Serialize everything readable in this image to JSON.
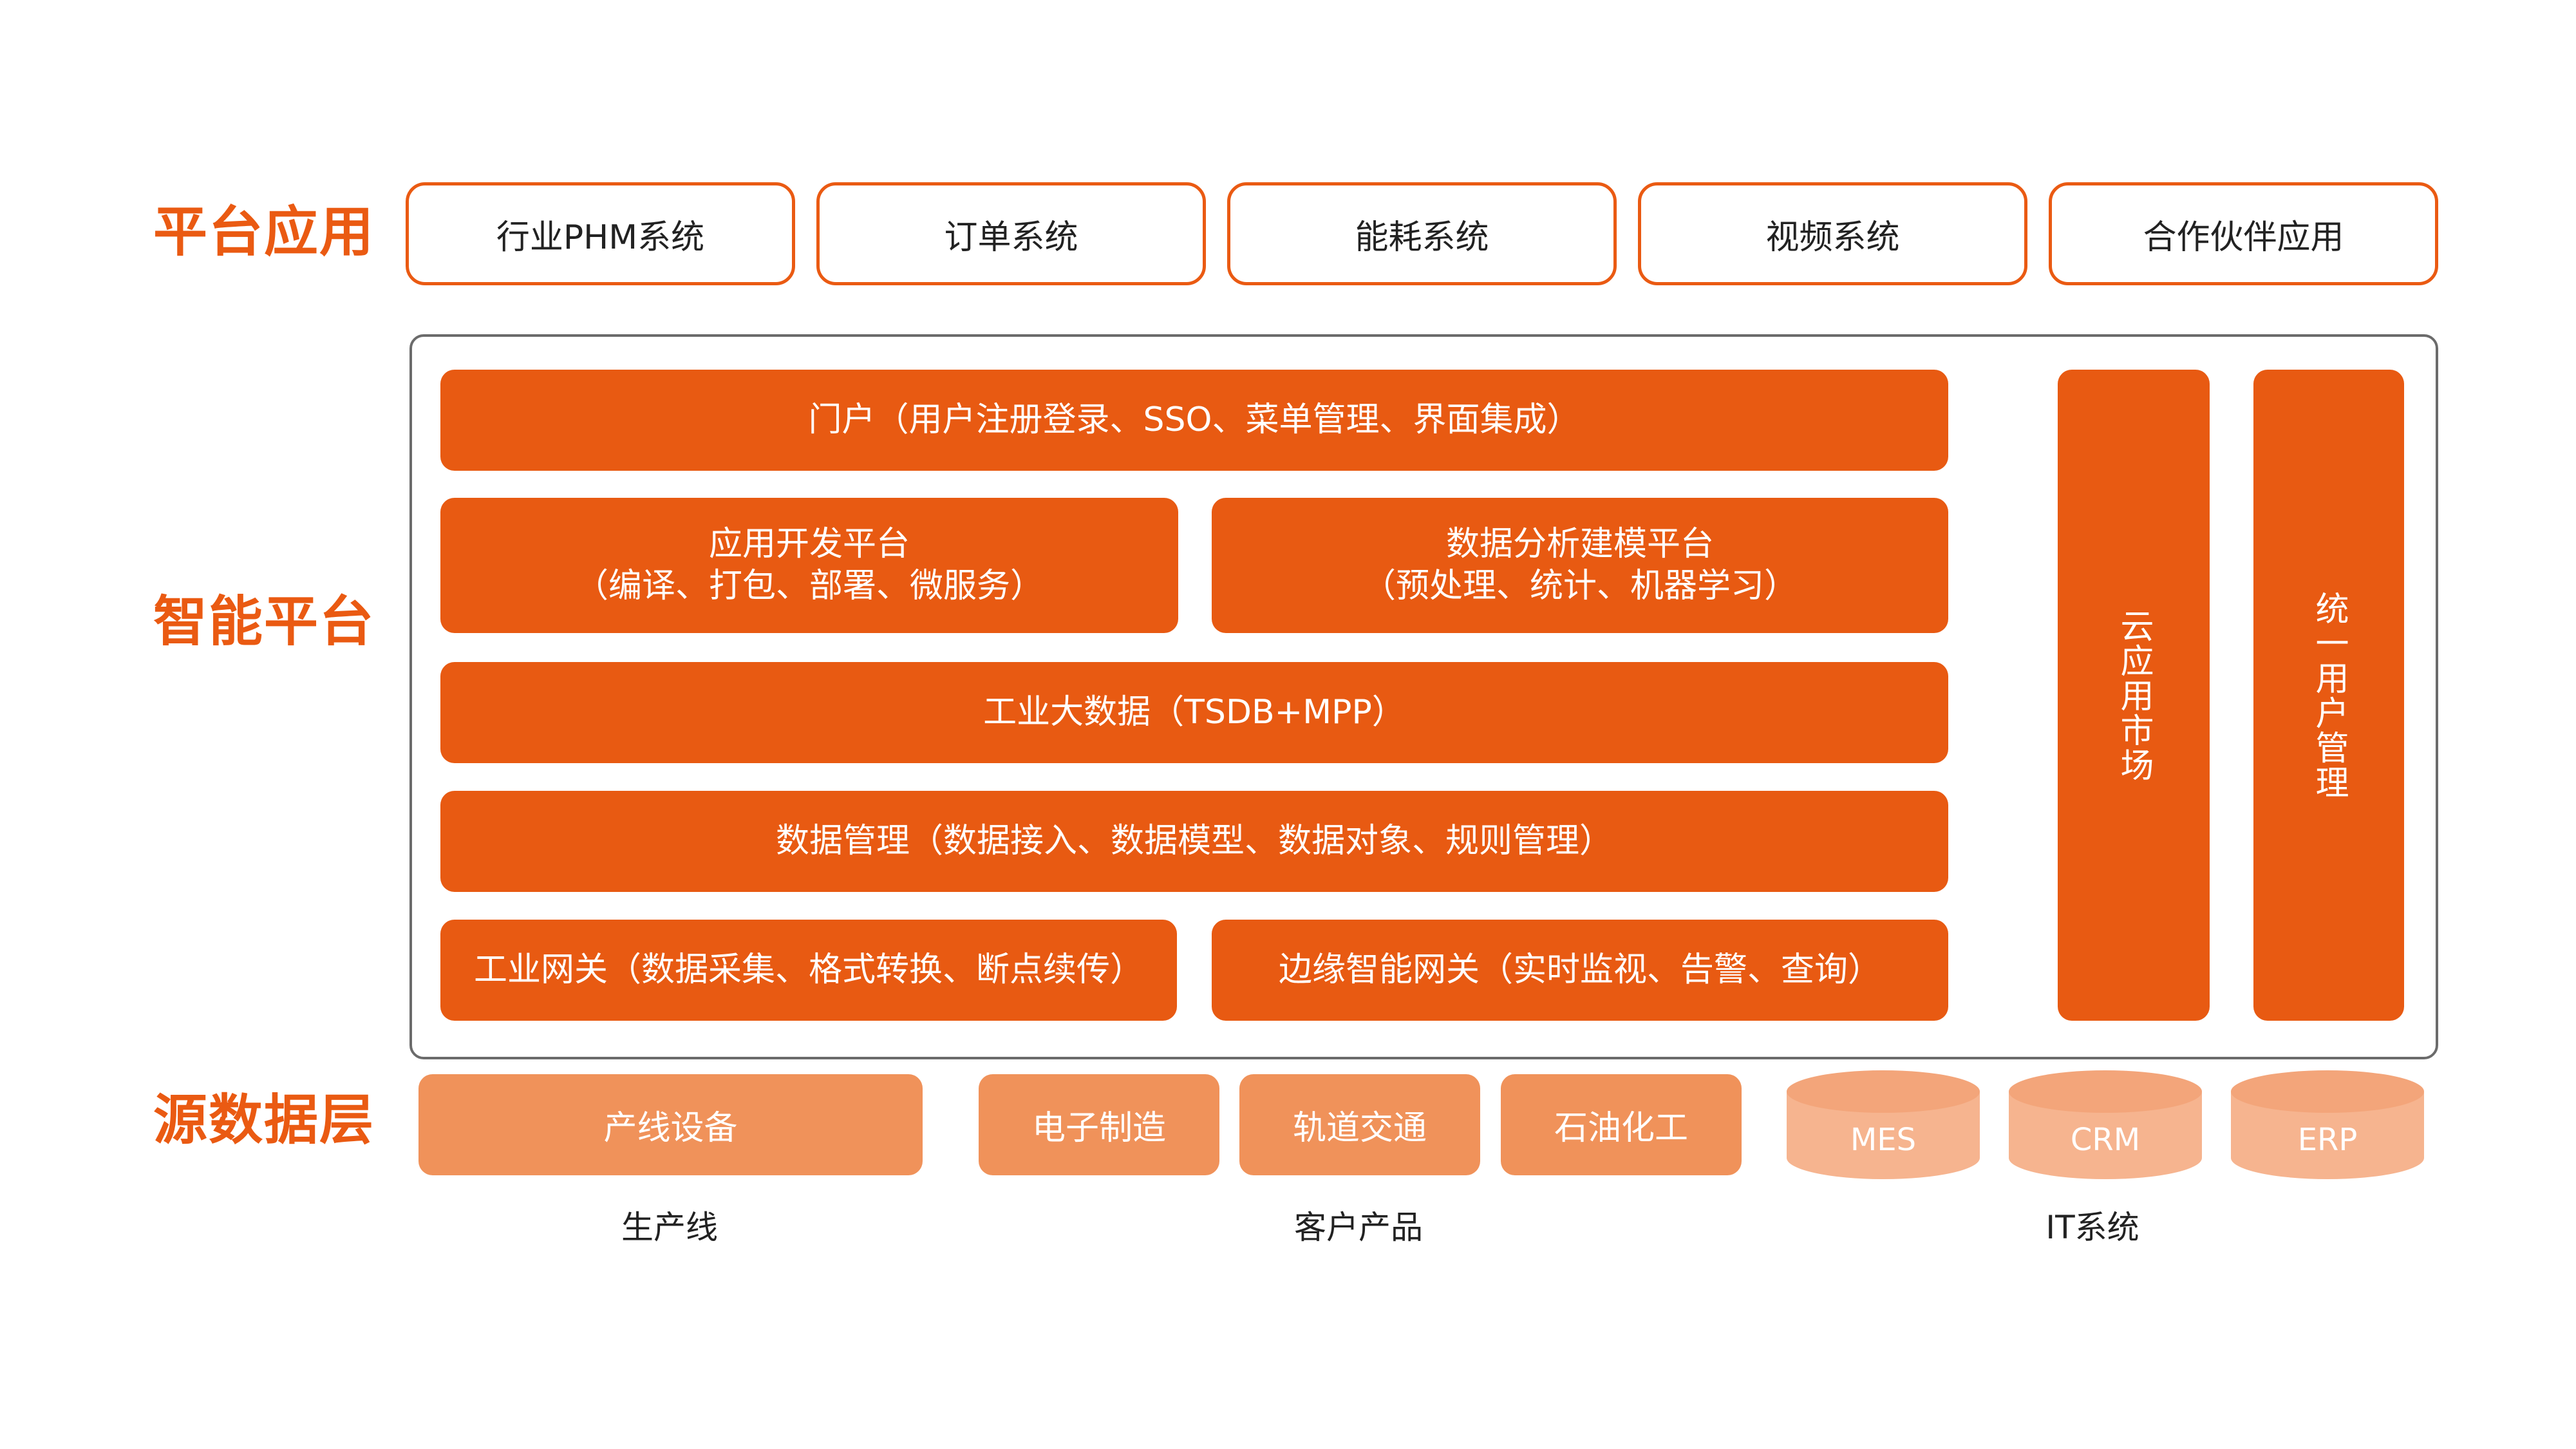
{
  "rows": {
    "apps_label": "平台应用",
    "platform_label": "智能平台",
    "source_label": "源数据层"
  },
  "apps": [
    "行业PHM系统",
    "订单系统",
    "能耗系统",
    "视频系统",
    "合作伙伴应用"
  ],
  "platform": {
    "portal": "门户（用户注册登录、SSO、菜单管理、界面集成）",
    "app_dev": {
      "title": "应用开发平台",
      "sub": "（编译、打包、部署、微服务）"
    },
    "data_analysis": {
      "title": "数据分析建模平台",
      "sub": "（预处理、统计、机器学习）"
    },
    "big_data": "工业大数据（TSDB+MPP）",
    "data_mgmt": "数据管理（数据接入、数据模型、数据对象、规则管理）",
    "gateway": "工业网关（数据采集、格式转换、断点续传）",
    "edge_gateway": "边缘智能网关（实时监视、告警、查询）",
    "cloud_market": "云应用市场",
    "user_mgmt": "统一用户管理"
  },
  "sources": {
    "production_line": {
      "items": [
        "产线设备"
      ],
      "label": "生产线"
    },
    "customer_products": {
      "items": [
        "电子制造",
        "轨道交通",
        "石油化工"
      ],
      "label": "客户产品"
    },
    "it_systems": {
      "items": [
        "MES",
        "CRM",
        "ERP"
      ],
      "label": "IT系统"
    }
  },
  "colors": {
    "accent": "#e85a12",
    "source_fill": "#f0925a",
    "cylinder_body": "#f6b48f",
    "cylinder_top": "#f3a57a",
    "frame_border": "#6b6b6b"
  }
}
